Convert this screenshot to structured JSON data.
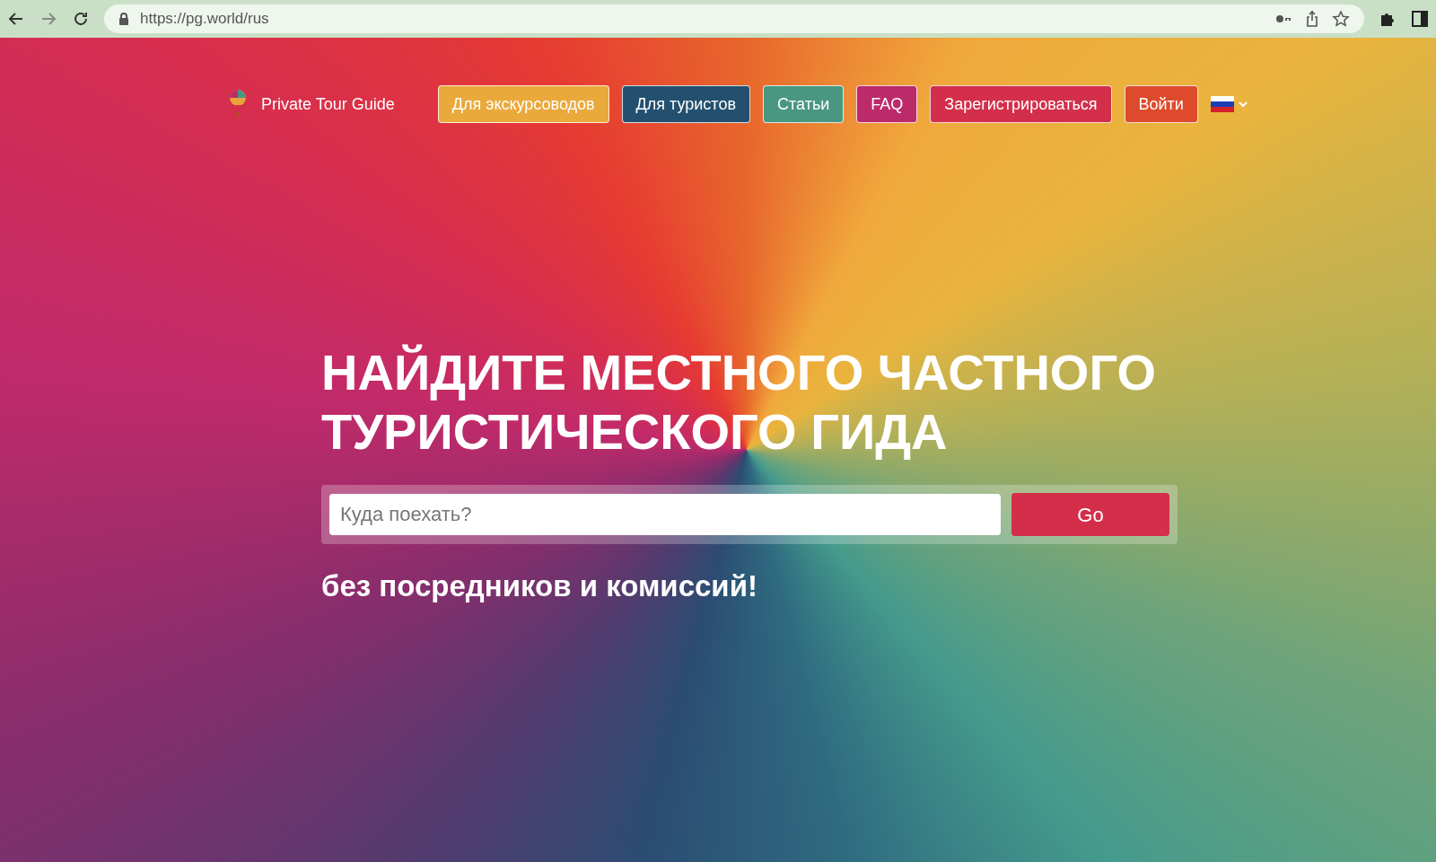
{
  "browser": {
    "url": "https://pg.world/rus"
  },
  "header": {
    "logo_text": "Private Tour Guide",
    "nav": [
      {
        "label": "Для экскурсоводов",
        "color": "#eaa93b"
      },
      {
        "label": "Для туристов",
        "color": "#24506f"
      },
      {
        "label": "Статьи",
        "color": "#4a9781"
      },
      {
        "label": "FAQ",
        "color": "#bd2a6a"
      },
      {
        "label": "Зарегистрироваться",
        "color": "#d32f4b"
      },
      {
        "label": "Войти",
        "color": "#de4a2c"
      }
    ]
  },
  "hero": {
    "title": "НАЙДИТЕ МЕСТНОГО ЧАСТНОГО ТУРИСТИЧЕСКОГО ГИДА",
    "search": {
      "placeholder": "Куда поехать?"
    },
    "button": "Go",
    "tagline": "без посредников и комиссий!"
  }
}
